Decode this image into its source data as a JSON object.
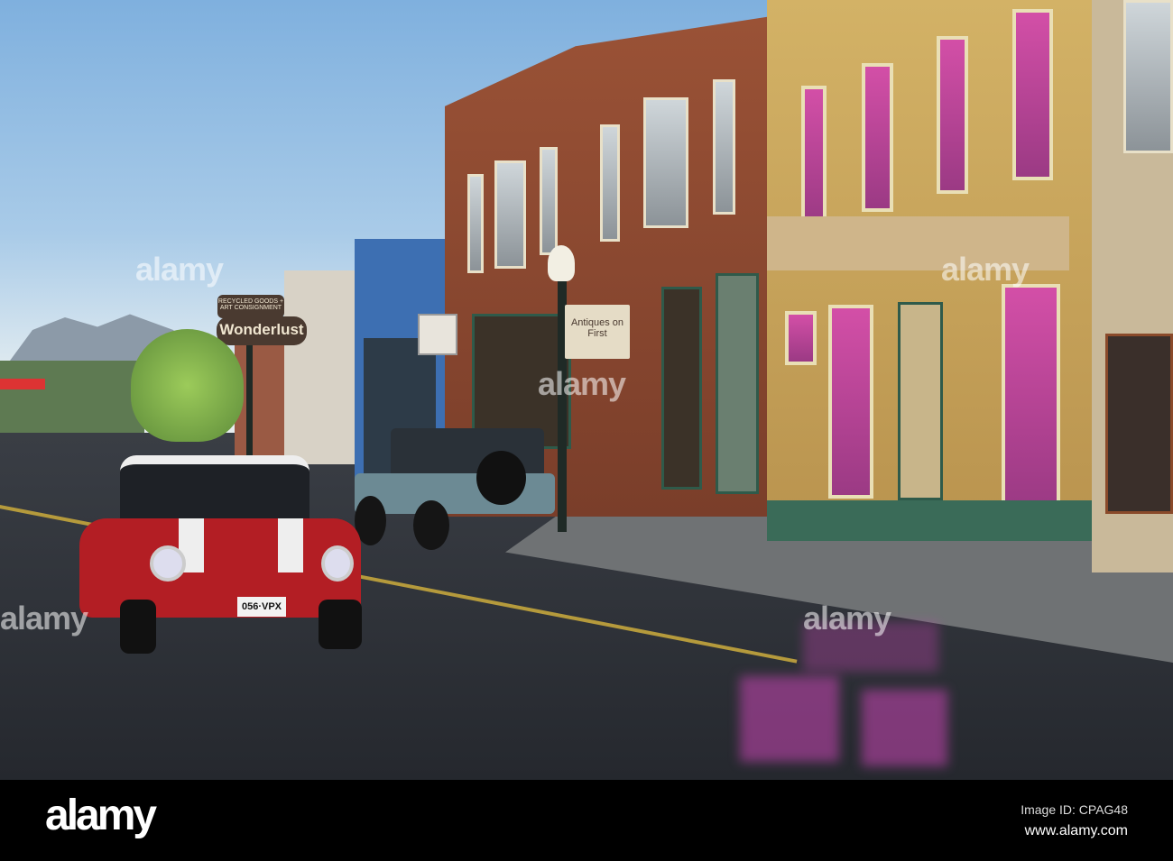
{
  "photo": {
    "signs": {
      "wonderlust_top": "RECYCLED GOODS + ART CONSIGNMENT",
      "wonderlust_name": "Wonderlust",
      "antiques": "Antiques on First"
    },
    "license_plate": "056·VPX",
    "watermark": "alamy"
  },
  "footer": {
    "logo": "alamy",
    "image_id": "Image ID: CPAG48",
    "url": "www.alamy.com"
  }
}
